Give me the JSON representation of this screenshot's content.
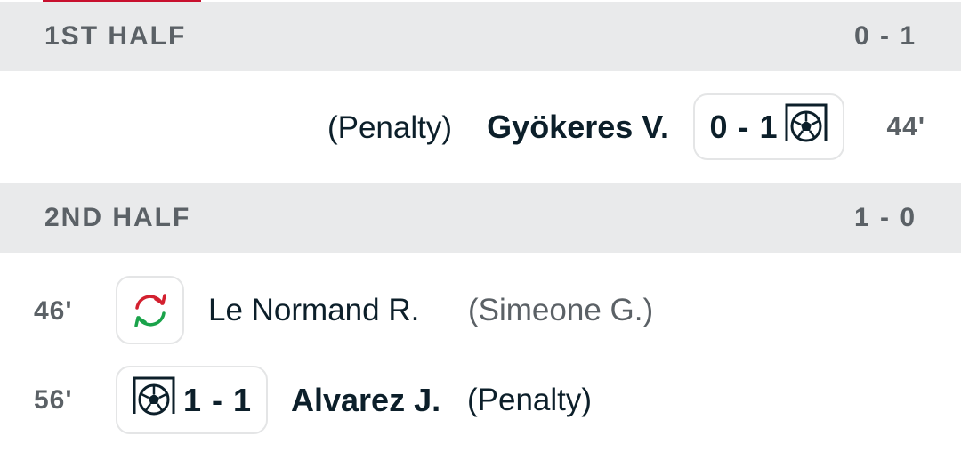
{
  "first_half": {
    "title": "1ST HALF",
    "score": "0 - 1",
    "incidents": [
      {
        "minute": "44'",
        "player": "Gyökeres V.",
        "note": "(Penalty)",
        "score": "0 - 1",
        "icon": "soccer-goal-icon"
      }
    ]
  },
  "second_half": {
    "title": "2ND HALF",
    "score": "1 - 0",
    "incidents": [
      {
        "minute": "46'",
        "player_in": "Le Normand R.",
        "player_out": "(Simeone G.)",
        "icon": "substitution-icon"
      },
      {
        "minute": "56'",
        "player": "Alvarez J.",
        "note": "(Penalty)",
        "score": "1 - 1",
        "icon": "soccer-goal-icon"
      }
    ]
  },
  "colors": {
    "accent": "#c8102e",
    "header_bg": "#e9eaeb",
    "text_dark": "#0c1f2a",
    "text_muted": "#5b6166",
    "sub_in": "#1aa34a",
    "sub_out": "#d3202f"
  }
}
